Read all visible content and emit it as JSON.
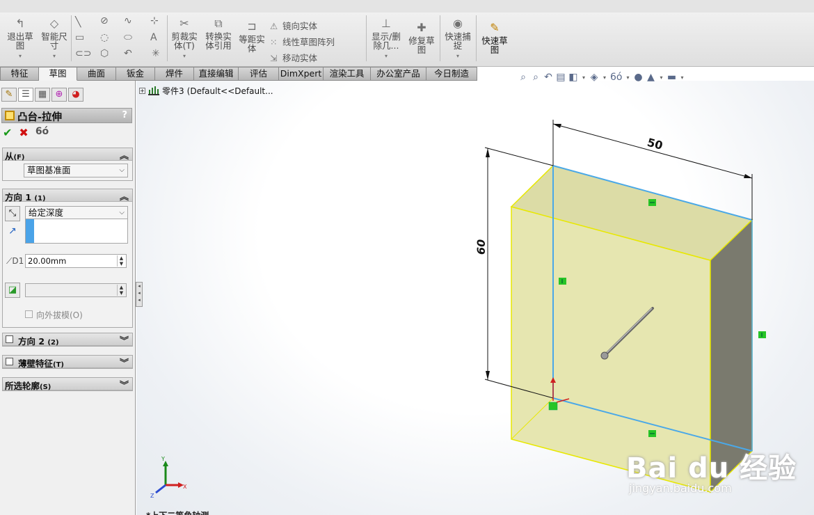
{
  "ribbon": {
    "buttons": [
      {
        "name": "exit-sketch-button",
        "label": "退出草图",
        "icon": "sketch-exit-icon"
      },
      {
        "name": "smart-dimension-button",
        "label": "智能尺寸",
        "icon": "dimension-icon"
      },
      {
        "name": "trim-entities-button",
        "label": "剪裁实体(T)",
        "icon": "trim-icon"
      },
      {
        "name": "convert-entities-button",
        "label": "转换实体引用",
        "icon": "convert-icon"
      },
      {
        "name": "offset-entities-button",
        "label": "等距实体",
        "icon": "offset-icon"
      },
      {
        "name": "display-delete-relations-button",
        "label": "显示/删除几...",
        "icon": "relations-icon"
      },
      {
        "name": "repair-sketch-button",
        "label": "修复草图",
        "icon": "repair-icon"
      },
      {
        "name": "quick-snaps-button",
        "label": "快速捕捉",
        "icon": "snap-icon"
      },
      {
        "name": "rapid-sketch-button",
        "label": "快速草图",
        "icon": "rapid-sketch-icon"
      }
    ],
    "list_buttons": [
      {
        "name": "mirror-entities-button",
        "label": "镜向实体",
        "icon": "mirror-icon"
      },
      {
        "name": "linear-pattern-button",
        "label": "线性草图阵列",
        "icon": "pattern-icon"
      },
      {
        "name": "move-entities-button",
        "label": "移动实体",
        "icon": "move-icon"
      }
    ]
  },
  "tabs": [
    "特征",
    "草图",
    "曲面",
    "钣金",
    "焊件",
    "直接编辑",
    "评估",
    "DimXpert",
    "渲染工具",
    "办公室产品",
    "今日制造"
  ],
  "active_tab": "草图",
  "panel": {
    "title": "凸台-拉伸",
    "help": "?",
    "actions": {
      "ok": "✔",
      "cancel": "✖",
      "preview": "6ó"
    },
    "from": {
      "label": "从",
      "shortcut": "(F)",
      "value": "草图基准面"
    },
    "direction1": {
      "label": "方向 1",
      "shortcut": "(1)",
      "end_condition": "给定深度",
      "depth": "20.00mm",
      "draft_outward": "向外拔模(O)"
    },
    "direction2": {
      "label": "方向 2",
      "shortcut": "(2)"
    },
    "thin_feature": {
      "label": "薄壁特征",
      "shortcut": "(T)"
    },
    "selected_contours": {
      "label": "所选轮廓",
      "shortcut": "(S)"
    }
  },
  "tree": {
    "part": "零件3",
    "config": "(Default<<Default..."
  },
  "viewport": {
    "dim_width": "50",
    "dim_height": "60",
    "triad": {
      "x": "X",
      "y": "Y",
      "z": "Z"
    },
    "bottom_text": "*上下二等角轴测",
    "box_face_color": "#e8e8b4",
    "box_side_color": "#7c7c70",
    "sketch_line_color": "#4aa8e8",
    "edge_color": "#f0f000"
  },
  "watermark": {
    "brand": "Bai du 经验",
    "url": "jingyan.baidu.com"
  }
}
